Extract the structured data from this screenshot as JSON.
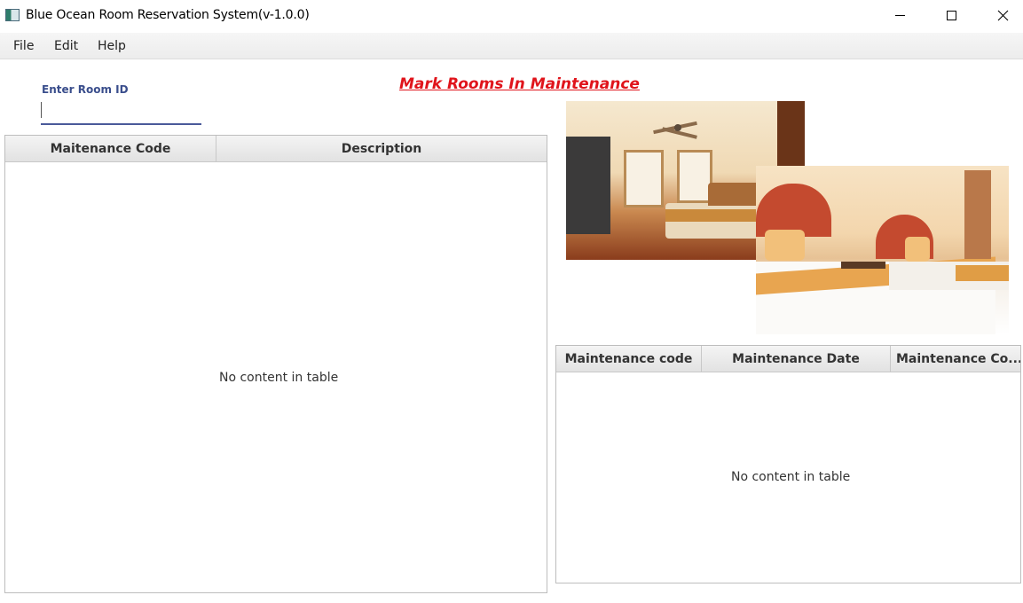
{
  "window": {
    "title": "Blue Ocean Room Reservation System(v-1.0.0)",
    "minimize_icon": "minimize-icon",
    "maximize_icon": "maximize-icon",
    "close_icon": "close-icon"
  },
  "menubar": {
    "items": [
      {
        "label": "File"
      },
      {
        "label": "Edit"
      },
      {
        "label": "Help"
      }
    ]
  },
  "form": {
    "room_id_label": "Enter Room ID",
    "room_id_value": ""
  },
  "page_title": "Mark Rooms In Maintenance",
  "left_table": {
    "columns": [
      "Maitenance Code",
      "Description"
    ],
    "rows": [],
    "empty_text": "No content in table"
  },
  "right_table": {
    "columns": [
      "Maintenance code",
      "Maintenance Date",
      "Maintenance Co..."
    ],
    "rows": [],
    "empty_text": "No content in table"
  },
  "colors": {
    "title_red": "#e0141b",
    "label_blue": "#3a4e8c"
  }
}
